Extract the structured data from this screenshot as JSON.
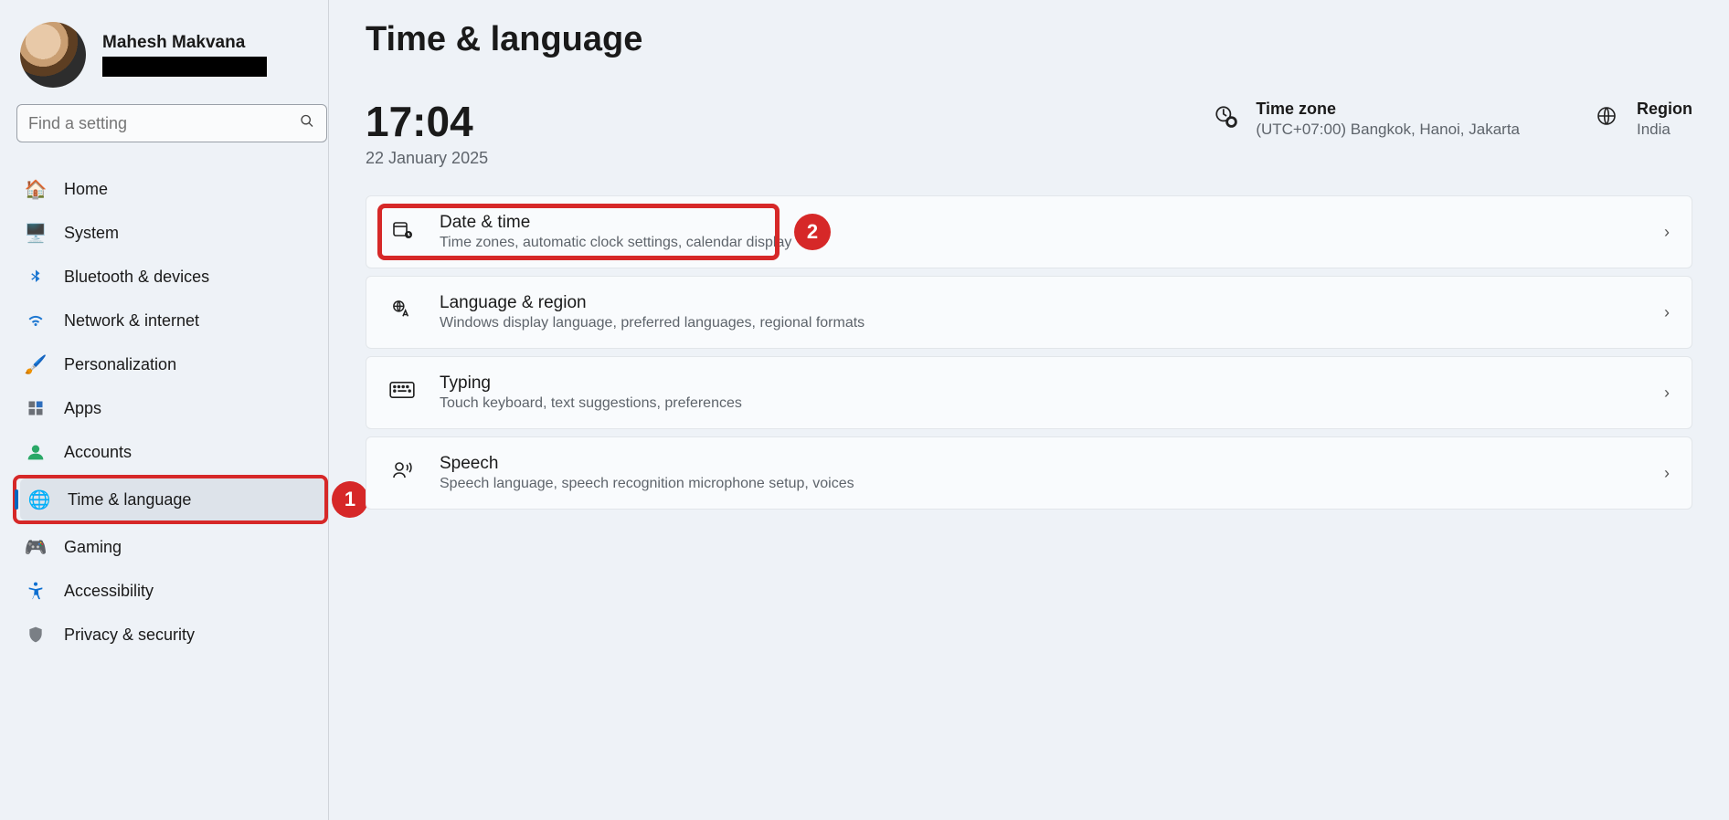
{
  "user": {
    "name": "Mahesh Makvana"
  },
  "search": {
    "placeholder": "Find a setting"
  },
  "nav": {
    "home": "Home",
    "system": "System",
    "bluetooth": "Bluetooth & devices",
    "network": "Network & internet",
    "personalization": "Personalization",
    "apps": "Apps",
    "accounts": "Accounts",
    "time_language": "Time & language",
    "gaming": "Gaming",
    "accessibility": "Accessibility",
    "privacy": "Privacy & security"
  },
  "callouts": {
    "one": "1",
    "two": "2"
  },
  "page": {
    "title": "Time & language",
    "clock_time": "17:04",
    "clock_date": "22 January 2025",
    "timezone_label": "Time zone",
    "timezone_value": "(UTC+07:00) Bangkok, Hanoi, Jakarta",
    "region_label": "Region",
    "region_value": "India"
  },
  "cards": {
    "datetime": {
      "title": "Date & time",
      "sub": "Time zones, automatic clock settings, calendar display"
    },
    "language": {
      "title": "Language & region",
      "sub": "Windows display language, preferred languages, regional formats"
    },
    "typing": {
      "title": "Typing",
      "sub": "Touch keyboard, text suggestions, preferences"
    },
    "speech": {
      "title": "Speech",
      "sub": "Speech language, speech recognition microphone setup, voices"
    }
  }
}
